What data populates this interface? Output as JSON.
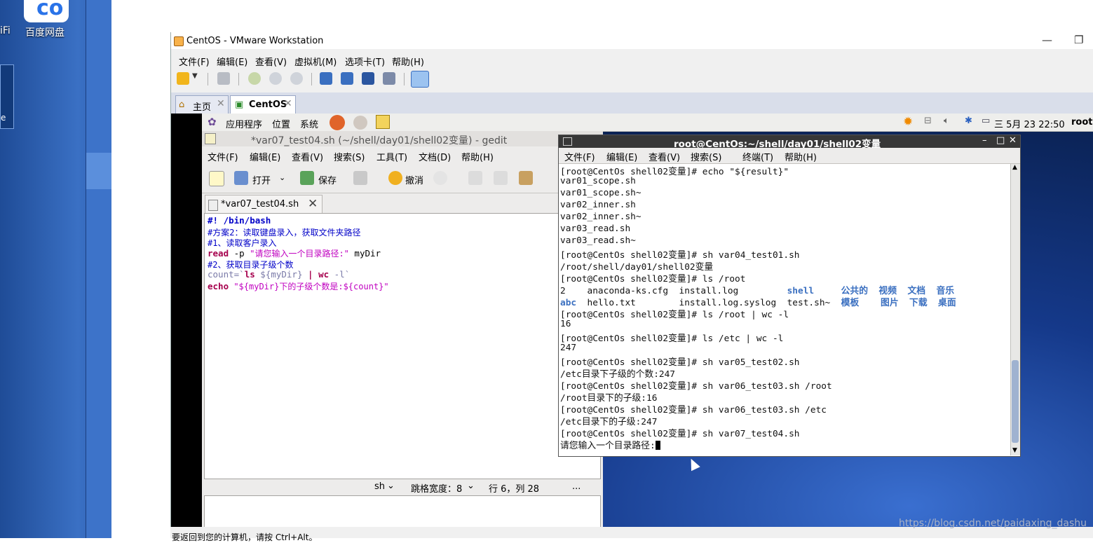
{
  "host": {
    "desktop_icons": [
      {
        "label": "百度网盘",
        "icon": "baidu-netdisk-icon"
      },
      {
        "label": "iFi",
        "icon": "wifi-app-icon"
      },
      {
        "label": "e",
        "icon": "app-icon"
      }
    ],
    "watermark": "https://blog.csdn.net/paidaxing_dashu"
  },
  "vmware": {
    "title": "CentOS - VMware Workstation",
    "controls": {
      "minimize": "—",
      "restore": "❐"
    },
    "menu": [
      "文件(F)",
      "编辑(E)",
      "查看(V)",
      "虚拟机(M)",
      "选项卡(T)",
      "帮助(H)"
    ],
    "tabs": [
      {
        "label": "主页",
        "icon": "home-icon",
        "active": false
      },
      {
        "label": "CentOS",
        "icon": "vm-icon",
        "active": true
      }
    ],
    "status_text": "要返回到您的计算机，请按 Ctrl+Alt。"
  },
  "gnome_panel": {
    "menus": [
      "应用程序",
      "位置",
      "系统"
    ],
    "datetime": "三 5月 23 22:50",
    "user": "root"
  },
  "gedit": {
    "title": "*var07_test04.sh (~/shell/day01/shell02变量) - gedit",
    "menu": [
      "文件(F)",
      "编辑(E)",
      "查看(V)",
      "搜索(S)",
      "工具(T)",
      "文档(D)",
      "帮助(H)"
    ],
    "toolbar": {
      "open": "打开",
      "save": "保存",
      "undo": "撤消"
    },
    "tab_label": "*var07_test04.sh",
    "code": {
      "l1": "#! /bin/bash",
      "l2": "#方案2：读取键盘录入，获取文件夹路径",
      "l3": "#1、读取客户录入",
      "l4_kw": "read",
      "l4_opt": " -p ",
      "l4_str": "\"请您输入一个目录路径:\"",
      "l4_rest": " myDir",
      "l5": "#2、获取目录子级个数",
      "l6_a": "count=`",
      "l6_ls": "ls",
      "l6_b": " ${myDir} ",
      "l6_pipe": "|",
      "l6_wc": " wc",
      "l6_c": " -l`",
      "l7_kw": "echo",
      "l7_str": " \"${myDir}下的子级个数是:${count}\""
    },
    "status": {
      "lang": "sh",
      "tab_width": "跳格宽度：8",
      "position": "行 6，列 28",
      "dots": "..."
    }
  },
  "terminal": {
    "title": "root@CentOs:~/shell/day01/shell02变量",
    "controls": {
      "min": "–",
      "max": "□",
      "close": "✕"
    },
    "menu": [
      "文件(F)",
      "编辑(E)",
      "查看(V)",
      "搜索(S)",
      "终端(T)",
      "帮助(H)"
    ],
    "lines": [
      "[root@CentOs shell02变量]# echo \"${result}\"",
      "var01_scope.sh",
      "var01_scope.sh~",
      "var02_inner.sh",
      "var02_inner.sh~",
      "var03_read.sh",
      "var03_read.sh~",
      "[root@CentOs shell02变量]# sh var04_test01.sh",
      "/root/shell/day01/shell02变量",
      "[root@CentOs shell02变量]# ls /root"
    ],
    "ls_row1": {
      "a": "2    anaconda-ks.cfg  install.log         ",
      "b": "shell     公共的  视频  文档  音乐"
    },
    "ls_row2": {
      "a": "abc",
      "b": "  hello.txt        install.log.syslog  test.sh~  ",
      "c": "模板    图片  下载  桌面"
    },
    "lines2": [
      "[root@CentOs shell02变量]# ls /root | wc -l",
      "16",
      "[root@CentOs shell02变量]# ls /etc | wc -l",
      "247",
      "[root@CentOs shell02变量]# sh var05_test02.sh",
      "/etc目录下子级的个数:247",
      "[root@CentOs shell02变量]# sh var06_test03.sh /root",
      "/root目录下的子级:16",
      "[root@CentOs shell02变量]# sh var06_test03.sh /etc",
      "/etc目录下的子级:247",
      "[root@CentOs shell02变量]# sh var07_test04.sh"
    ],
    "prompt": "请您输入一个目录路径:"
  }
}
